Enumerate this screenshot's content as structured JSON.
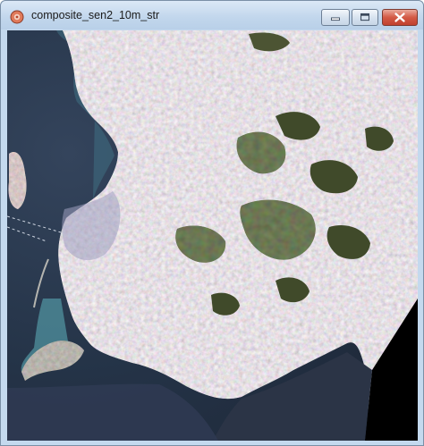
{
  "window": {
    "title": "composite_sen2_10m_str",
    "frame_color": "#c4d9ee",
    "title_text_color": "#1b1b1b"
  },
  "controls": {
    "minimize_icon": "minimize-icon",
    "maximize_icon": "maximize-icon",
    "close_icon": "close-icon",
    "close_color": "#c8452f"
  },
  "image": {
    "content": "satellite true-color composite",
    "colors": {
      "sea": "#243347",
      "shallow_water": "#5aa8b4",
      "land": "#c9bfbd",
      "forest": "#404a2a",
      "nodata": "#000000"
    }
  }
}
